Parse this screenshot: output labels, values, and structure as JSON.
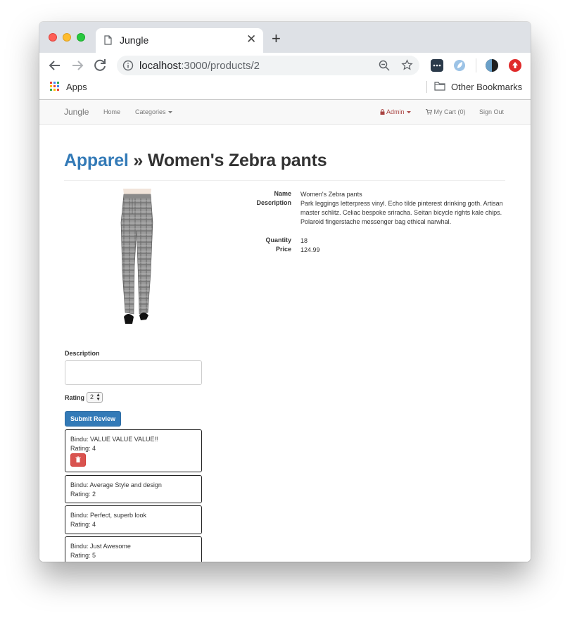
{
  "browser": {
    "tab_title": "Jungle",
    "url_host": "localhost",
    "url_path": ":3000/products/2",
    "bookmarks": {
      "apps_label": "Apps",
      "other_label": "Other Bookmarks"
    }
  },
  "navbar": {
    "brand": "Jungle",
    "home": "Home",
    "categories": "Categories",
    "admin": "Admin",
    "cart": "My Cart (0)",
    "sign_out": "Sign Out"
  },
  "heading": {
    "category": "Apparel",
    "separator": " » ",
    "product": "Women's Zebra pants"
  },
  "details": {
    "name_label": "Name",
    "name": "Women's Zebra pants",
    "description_label": "Description",
    "description": "Park leggings letterpress vinyl. Echo tilde pinterest drinking goth. Artisan master schlitz. Celiac bespoke sriracha. Seitan bicycle rights kale chips. Polaroid fingerstache messenger bag ethical narwhal.",
    "quantity_label": "Quantity",
    "quantity": "18",
    "price_label": "Price",
    "price": "124.99"
  },
  "review_form": {
    "description_label": "Description",
    "description_value": "",
    "rating_label": "Rating",
    "rating_value": "2",
    "submit_label": "Submit Review"
  },
  "reviews": [
    {
      "text": "Bindu: VALUE VALUE VALUE!!",
      "rating": "Rating: 4",
      "deletable": true
    },
    {
      "text": "Bindu: Average Style and design",
      "rating": "Rating: 2",
      "deletable": false
    },
    {
      "text": "Bindu: Perfect, superb look",
      "rating": "Rating: 4",
      "deletable": false
    },
    {
      "text": "Bindu: Just Awesome",
      "rating": "Rating: 5",
      "deletable": false
    }
  ],
  "colors": {
    "link_blue": "#337ab7",
    "admin_red": "#a94442",
    "delete_red": "#d9534f"
  }
}
